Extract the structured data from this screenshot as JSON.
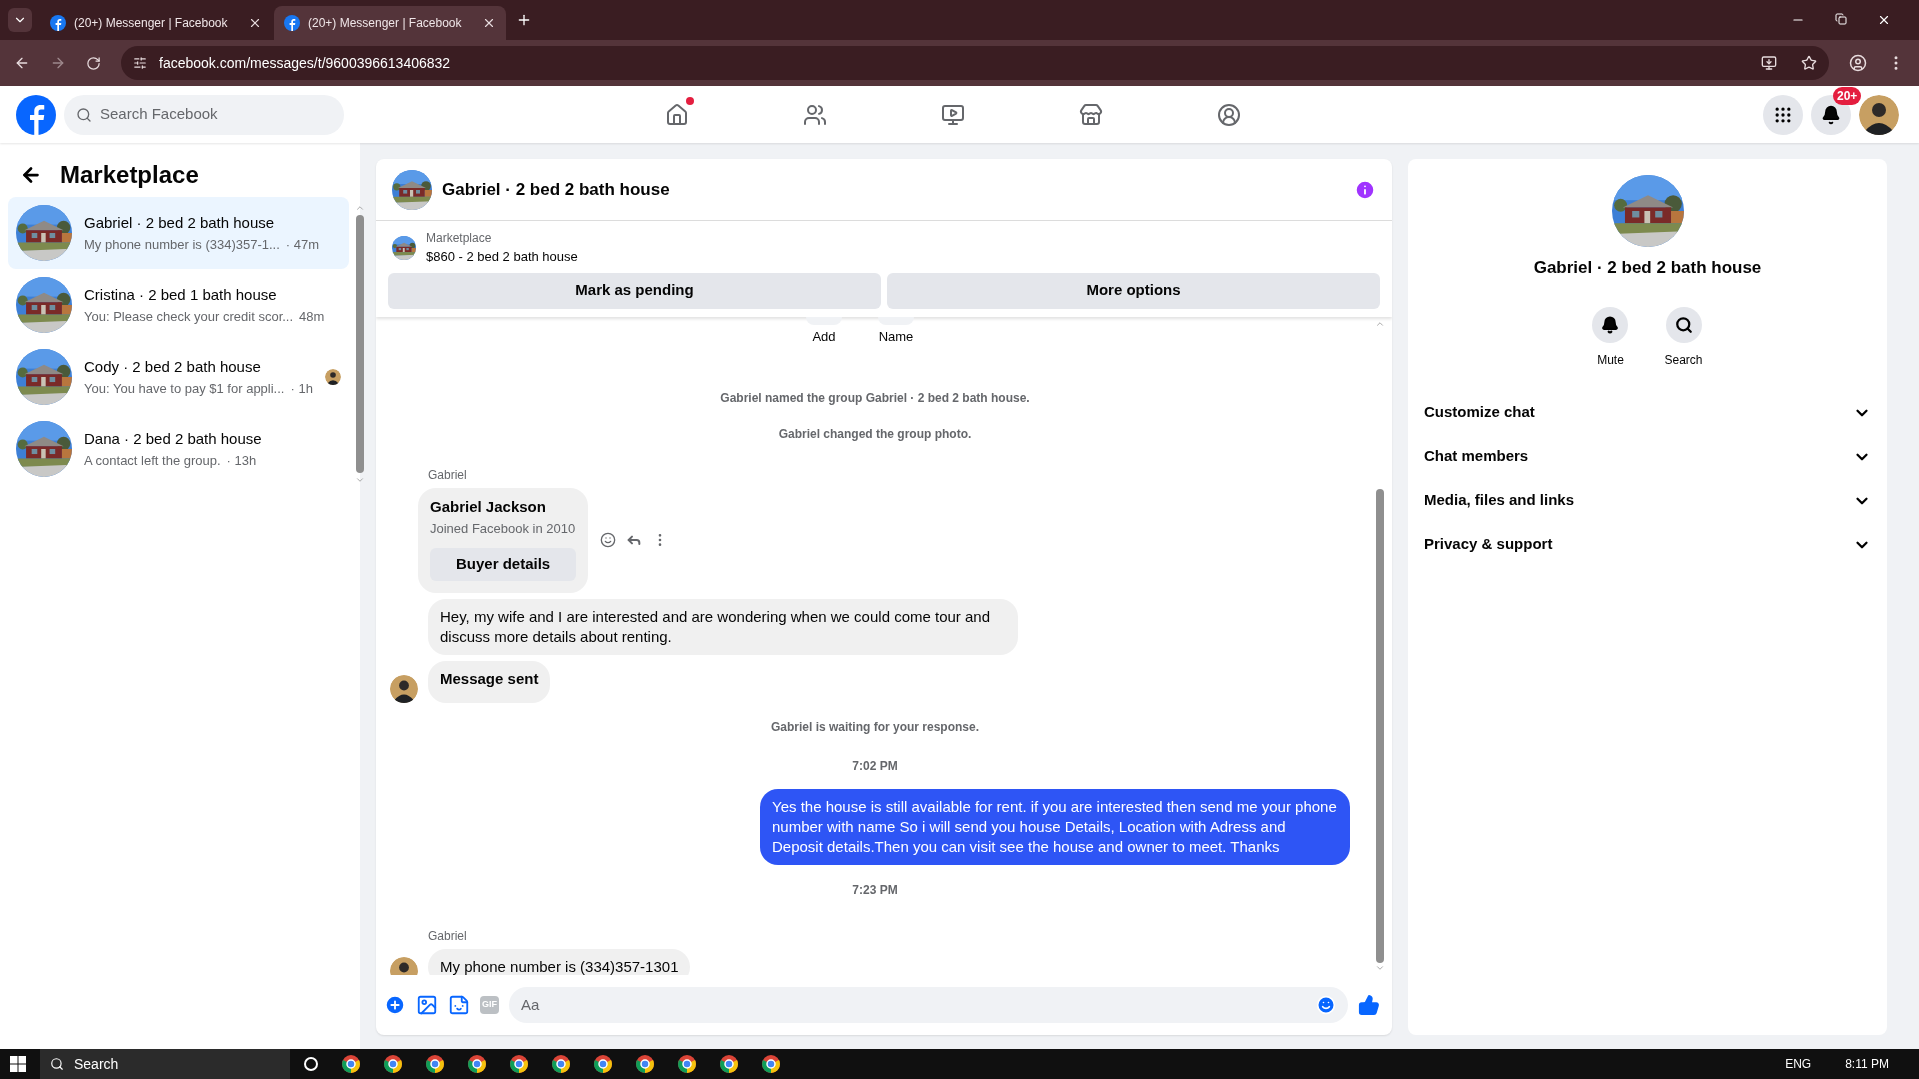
{
  "browser": {
    "tabs": [
      {
        "title": "(20+) Messenger | Facebook",
        "selected": false
      },
      {
        "title": "(20+) Messenger | Facebook",
        "selected": true
      }
    ],
    "url": "facebook.com/messages/t/9600396613406832"
  },
  "header": {
    "search_placeholder": "Search Facebook",
    "nav": [
      {
        "kind": "home",
        "unread": true
      },
      {
        "kind": "friends",
        "unread": false
      },
      {
        "kind": "video",
        "unread": false
      },
      {
        "kind": "marketplace",
        "unread": false
      },
      {
        "kind": "gaming",
        "unread": false
      }
    ],
    "notification_badge": "20+"
  },
  "sidebar": {
    "title": "Marketplace",
    "conversations": [
      {
        "name": "Gabriel · 2 bed 2 bath house",
        "preview": "My phone number is (334)357-1...",
        "time": "· 47m",
        "selected": true,
        "seen": false
      },
      {
        "name": "Cristina · 2 bed 1 bath house",
        "preview": "You: Please check your credit scor...",
        "time": "48m",
        "selected": false,
        "seen": false
      },
      {
        "name": "Cody · 2 bed 2 bath house",
        "preview": "You: You have to pay $1 for appli...",
        "time": "· 1h",
        "selected": false,
        "seen": true
      },
      {
        "name": "Dana · 2 bed 2 bath house",
        "preview": "A contact left the group.",
        "time": "· 13h",
        "selected": false,
        "seen": false
      }
    ]
  },
  "chat": {
    "title": "Gabriel · 2 bed 2 bath house",
    "listing": {
      "label": "Marketplace",
      "title": "$860 - 2 bed 2 bath house"
    },
    "buttons": [
      "Mark as pending",
      "More options"
    ],
    "group_actions": [
      "Add",
      "Name"
    ],
    "messages": [
      {
        "kind": "event",
        "text": "Gabriel named the group Gabriel · 2 bed 2 bath house."
      },
      {
        "kind": "event",
        "text": "Gabriel changed the group photo."
      },
      {
        "kind": "sender",
        "text": "Gabriel"
      },
      {
        "kind": "card",
        "name": "Gabriel Jackson",
        "subtitle": "Joined Facebook in 2010",
        "button": "Buyer details"
      },
      {
        "kind": "incoming",
        "text": "Hey, my wife and I are interested and are wondering when we could come tour and discuss more details about renting.",
        "avatar": false,
        "bold": false
      },
      {
        "kind": "incoming",
        "text": "Message sent",
        "avatar": true,
        "bold": true
      },
      {
        "kind": "event",
        "text": "Gabriel is waiting for your response."
      },
      {
        "kind": "time",
        "text": "7:02 PM"
      },
      {
        "kind": "outgoing",
        "text": "Yes the house is still available for rent. if you are interested then send me your phone number with name So i will send you house Details, Location with Adress and Deposit details.Then you can visit see the house and owner to meet. Thanks"
      },
      {
        "kind": "time",
        "text": "7:23 PM"
      },
      {
        "kind": "sender",
        "text": "Gabriel"
      },
      {
        "kind": "incoming",
        "text": "My phone number is (334)357-1301",
        "avatar": true,
        "bold": false
      }
    ],
    "composer": {
      "placeholder": "Aa",
      "gif_label": "GIF"
    }
  },
  "details": {
    "title": "Gabriel · 2 bed 2 bath house",
    "actions": [
      {
        "kind": "mute",
        "label": "Mute"
      },
      {
        "kind": "search",
        "label": "Search"
      }
    ],
    "sections": [
      {
        "label": "Customize chat",
        "expanded": false
      },
      {
        "label": "Chat members",
        "expanded": false
      },
      {
        "label": "Media, files and links",
        "expanded": false
      },
      {
        "label": "Privacy & support",
        "expanded": false
      }
    ]
  },
  "taskbar": {
    "search": "Search",
    "language": "ENG",
    "clock": "8:11 PM"
  }
}
